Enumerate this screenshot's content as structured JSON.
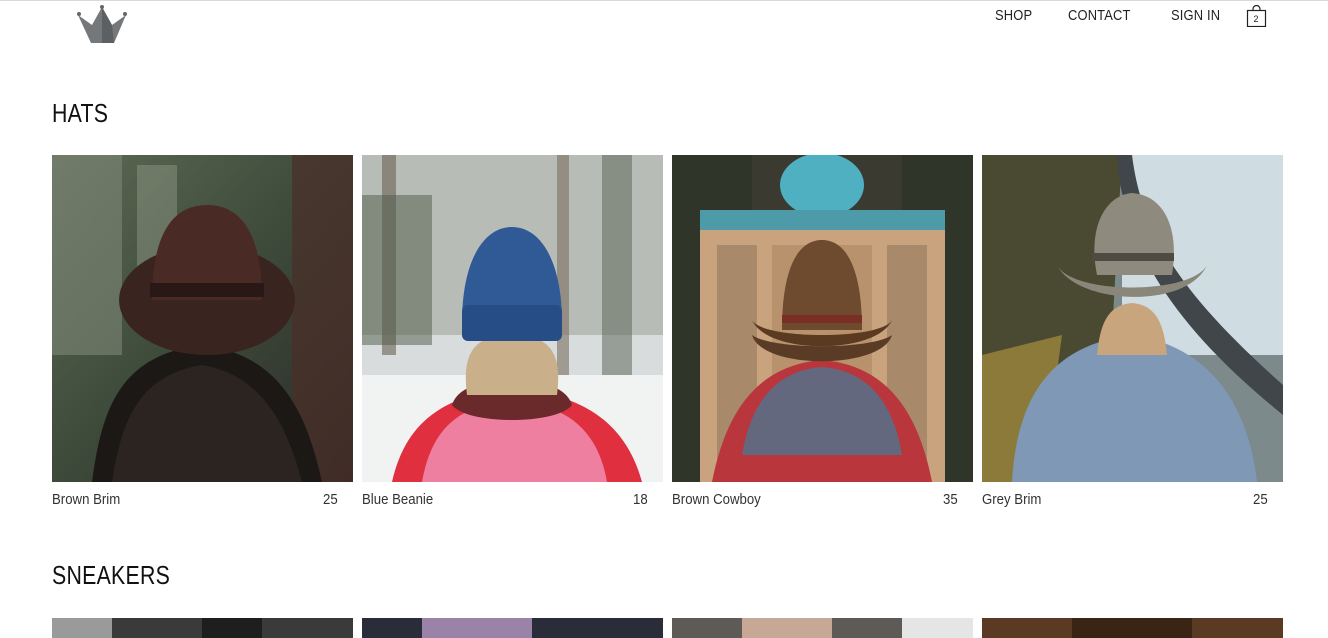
{
  "header": {
    "logo": "crown-logo",
    "nav": [
      "SHOP",
      "CONTACT",
      "SIGN IN"
    ],
    "cart_count": "2"
  },
  "sections": [
    {
      "title": "HATS",
      "items": [
        {
          "name": "Brown Brim",
          "price": "25",
          "image": "woman-brown-brim-hat-forest"
        },
        {
          "name": "Blue Beanie",
          "price": "18",
          "image": "woman-blue-beanie-snow"
        },
        {
          "name": "Brown Cowboy",
          "price": "35",
          "image": "person-brown-cowboy-hat-mosque"
        },
        {
          "name": "Grey Brim",
          "price": "25",
          "image": "man-grey-brim-hat-coast"
        }
      ]
    },
    {
      "title": "SNEAKERS",
      "items": [
        {
          "image": "sneaker-photo-1"
        },
        {
          "image": "sneaker-photo-2"
        },
        {
          "image": "sneaker-photo-3"
        },
        {
          "image": "sneaker-photo-4"
        }
      ]
    }
  ],
  "colors": {
    "text": "#222222",
    "background": "#ffffff",
    "logo": "#6e7072"
  }
}
